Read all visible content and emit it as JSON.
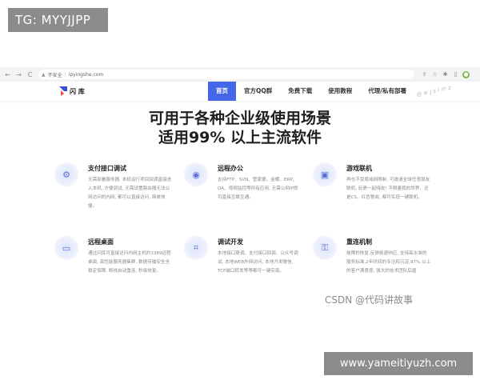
{
  "watermark_top": "TG: MYYJJPP",
  "browser": {
    "back": "←",
    "forward": "→",
    "reload": "C",
    "security_label": "不安全",
    "url": "ipyingshe.com",
    "icons": [
      "share-icon",
      "star-icon",
      "extension-icon",
      "menu-icon",
      "profile-icon"
    ]
  },
  "site": {
    "logo_text": "闪 库",
    "menu": [
      {
        "label": "首页",
        "active": true
      },
      {
        "label": "官方QQ群",
        "active": false
      },
      {
        "label": "免费下载",
        "active": false
      },
      {
        "label": "使用教程",
        "active": false
      },
      {
        "label": "代理/私有部署",
        "active": false
      }
    ],
    "nav_watermark": "@ w j s i m z"
  },
  "hero": {
    "title": "可用于各种企业级使用场景",
    "subtitle": "适用99% 以上主流软件"
  },
  "features": [
    {
      "icon": "api-debug-icon",
      "glyph": "⚙",
      "title": "支付接口调试",
      "desc": "无需部署服务器, 本机运行项目回调直接进入本机, 方便调试, 无需设置路由器无法公网访问的内网, 都可以直接访问, 简单快捷。"
    },
    {
      "icon": "remote-office-icon",
      "glyph": "◉",
      "title": "远程办公",
      "desc": "支持FTP、SVN、管家婆、金蝶、ERP、OA、视频监控等所有应用, 无需公网IP即可直接互联互通。"
    },
    {
      "icon": "game-lan-icon",
      "glyph": "▣",
      "title": "游戏联机",
      "desc": "再也不受局域网限制, 可邀请全球任意朋友联机, 玩更一起嗨皮! 不限量我的世界、还是CS、红色警戒, 都可实现一键联机。"
    },
    {
      "icon": "remote-desktop-icon",
      "glyph": "▭",
      "title": "远程桌面",
      "desc": "通过闪库可直接访问内网主机的3389远程桌面, 高性能服务器集群, 数据传输安全全稳定保障, 断线自动重连, 秒级恢复。"
    },
    {
      "icon": "dev-debug-icon",
      "glyph": "⌗",
      "title": "调试开发",
      "desc": "本地接口联调、支付接口回调、公众号调试, 本地WEB外网访问, 本地开发微信, TCP端口转发等等都可一键实现。"
    },
    {
      "icon": "reconnect-icon",
      "glyph": "⚿",
      "title": "重连机制",
      "desc": "故障秒恢复,反馈极速响应, 支持高水准的服务标准,2年时间的专注和沉淀,97% 以上的客户满意度, 强大的技术团队后盾"
    }
  ],
  "watermark_csdn": "CSDN @代码讲故事",
  "watermark_bottom": "www.yameitiyuzh.com"
}
